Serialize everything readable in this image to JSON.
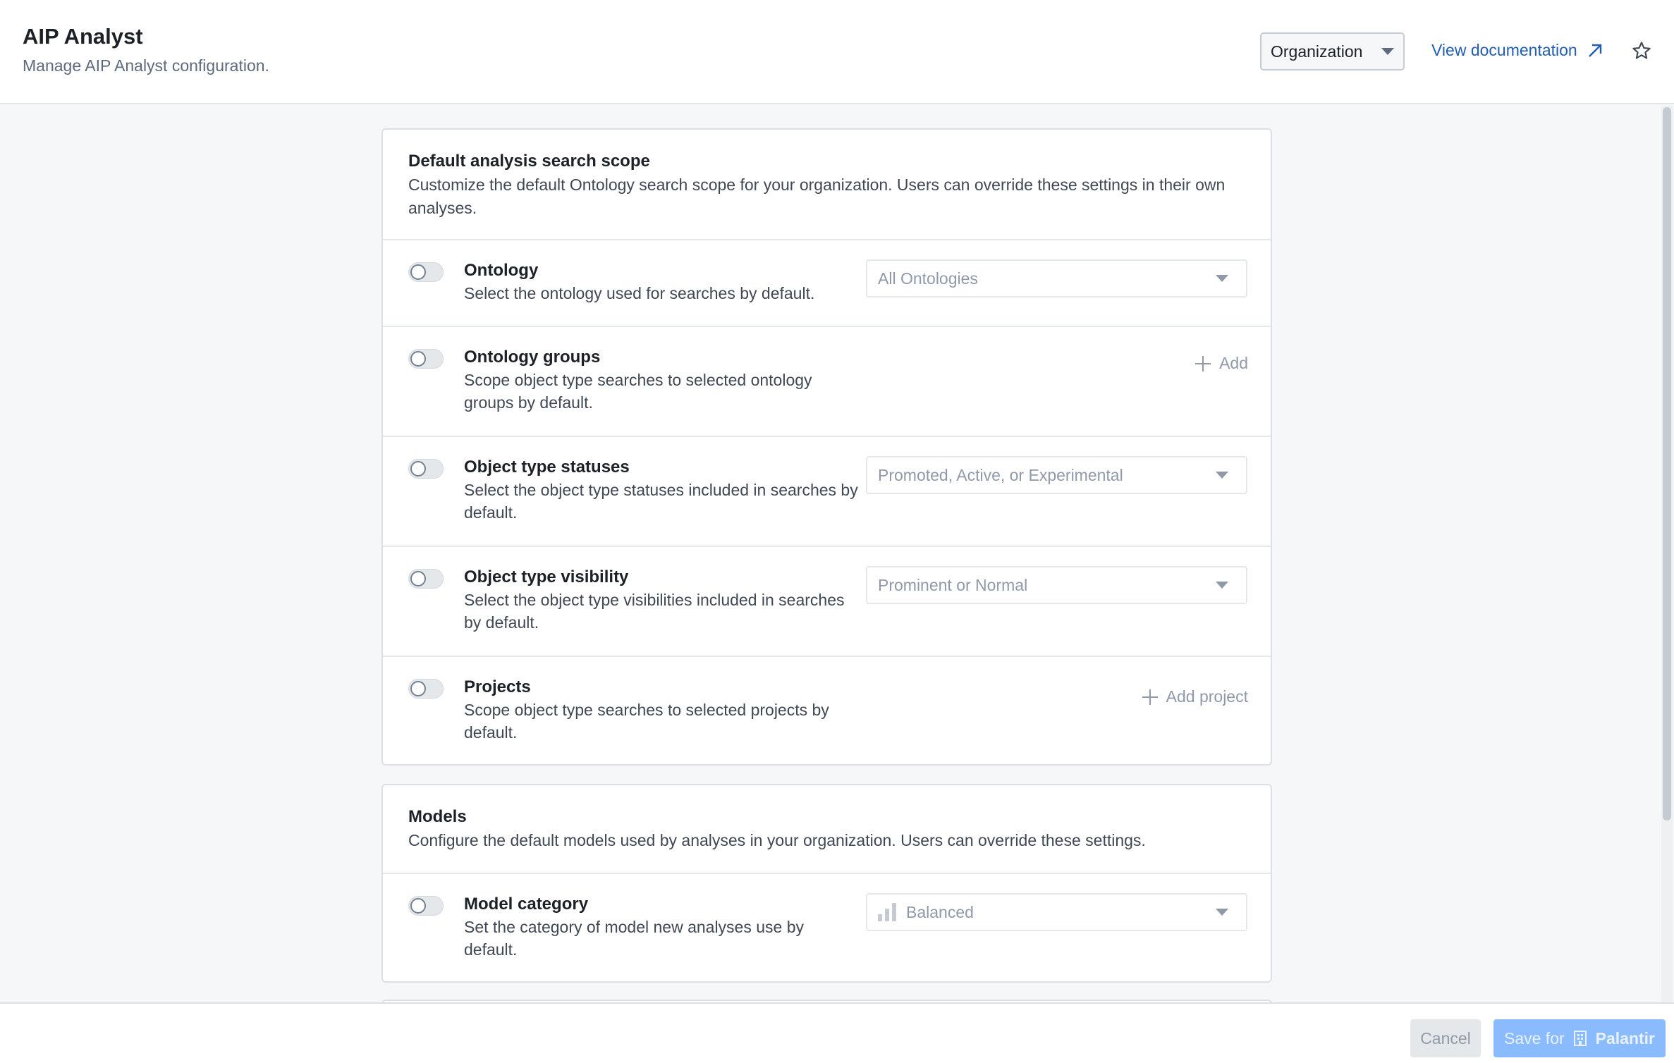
{
  "header": {
    "title": "AIP Analyst",
    "subtitle": "Manage AIP Analyst configuration.",
    "scope_select": "Organization",
    "doc_link": "View documentation"
  },
  "search_scope": {
    "title": "Default analysis search scope",
    "description": "Customize the default Ontology search scope for your organization. Users can override these settings in their own analyses.",
    "rows": [
      {
        "title": "Ontology",
        "description": "Select the ontology used for searches by default.",
        "control": "select",
        "value": "All Ontologies",
        "enabled": false
      },
      {
        "title": "Ontology groups",
        "description": "Scope object type searches to selected ontology groups by default.",
        "control": "add",
        "value": "Add",
        "enabled": false
      },
      {
        "title": "Object type statuses",
        "description": "Select the object type statuses included in searches by default.",
        "control": "select",
        "value": "Promoted, Active, or Experimental",
        "enabled": false
      },
      {
        "title": "Object type visibility",
        "description": "Select the object type visibilities included in searches by default.",
        "control": "select",
        "value": "Prominent or Normal",
        "enabled": false
      },
      {
        "title": "Projects",
        "description": "Scope object type searches to selected projects by default.",
        "control": "add",
        "value": "Add project",
        "enabled": false
      }
    ]
  },
  "models": {
    "title": "Models",
    "description": "Configure the default models used by analyses in your organization. Users can override these settings.",
    "rows": [
      {
        "title": "Model category",
        "description": "Set the category of model new analyses use by default.",
        "control": "select",
        "value": "Balanced",
        "icon": "bar-chart-icon",
        "enabled": false
      }
    ]
  },
  "footer": {
    "cancel_label": "Cancel",
    "save_label": "Save for",
    "save_org": "Palantir",
    "save_icon": "building-icon"
  },
  "colors": {
    "link": "#215db0",
    "save_button": "#8abbff",
    "border": "#dce0e5"
  }
}
